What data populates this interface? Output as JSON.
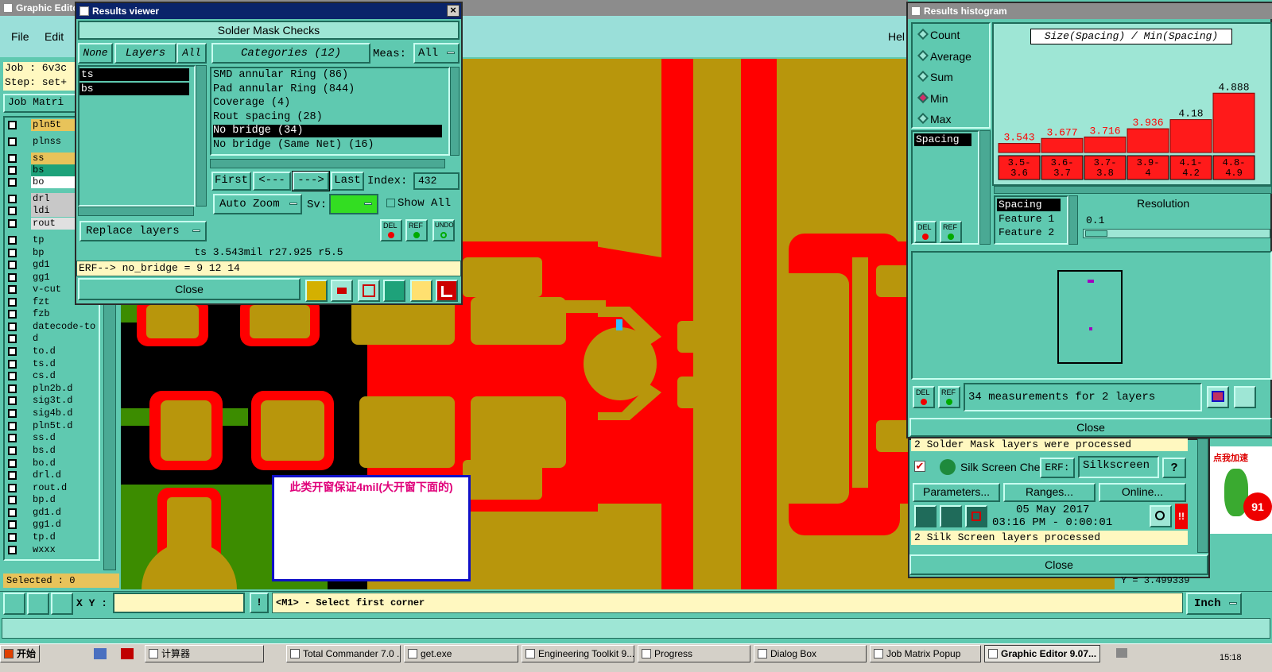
{
  "graphic_editor": {
    "title": "Graphic Edito",
    "menu_file": "File",
    "menu_edit": "Edit",
    "menu_help": "Hel",
    "job": "Job : 6v3c",
    "step": "Step: set+",
    "job_matrix": "Job Matri",
    "selected": "Selected : 0",
    "xy_label": "X Y :",
    "xy_value": "",
    "status_msg": "<M1> - Select first corner",
    "units": "Inch",
    "y_readout": "Y = 3.499339",
    "layers": [
      {
        "name": "pln5t",
        "bg": "#e8c35a"
      },
      {
        "name": "plnss",
        "bg": "#5fc9b0"
      },
      {
        "name": "ss",
        "bg": "#e8c35a"
      },
      {
        "name": "bs",
        "bg": "#1ea27a"
      },
      {
        "name": "bo",
        "bg": "#ffffff"
      },
      {
        "name": "drl",
        "bg": "#c8c8c8"
      },
      {
        "name": "ldi",
        "bg": "#c8c8c8"
      },
      {
        "name": "rout",
        "bg": "#e0e0e0"
      },
      {
        "name": "tp",
        "bg": "#5fc9b0"
      },
      {
        "name": "bp",
        "bg": "#5fc9b0"
      },
      {
        "name": "gd1",
        "bg": "#5fc9b0"
      },
      {
        "name": "gg1",
        "bg": "#5fc9b0"
      },
      {
        "name": "v-cut",
        "bg": "#5fc9b0"
      },
      {
        "name": "fzt",
        "bg": "#5fc9b0"
      },
      {
        "name": "fzb",
        "bg": "#5fc9b0"
      },
      {
        "name": "datecode-to",
        "bg": "#5fc9b0"
      },
      {
        "name": "d",
        "bg": "#5fc9b0"
      },
      {
        "name": "to.d",
        "bg": "#5fc9b0"
      },
      {
        "name": "ts.d",
        "bg": "#5fc9b0"
      },
      {
        "name": "cs.d",
        "bg": "#5fc9b0"
      },
      {
        "name": "pln2b.d",
        "bg": "#5fc9b0"
      },
      {
        "name": "sig3t.d",
        "bg": "#5fc9b0"
      },
      {
        "name": "sig4b.d",
        "bg": "#5fc9b0"
      },
      {
        "name": "pln5t.d",
        "bg": "#5fc9b0"
      },
      {
        "name": "ss.d",
        "bg": "#5fc9b0"
      },
      {
        "name": "bs.d",
        "bg": "#5fc9b0"
      },
      {
        "name": "bo.d",
        "bg": "#5fc9b0"
      },
      {
        "name": "drl.d",
        "bg": "#5fc9b0"
      },
      {
        "name": "rout.d",
        "bg": "#5fc9b0"
      },
      {
        "name": "bp.d",
        "bg": "#5fc9b0"
      },
      {
        "name": "gd1.d",
        "bg": "#5fc9b0"
      },
      {
        "name": "gg1.d",
        "bg": "#5fc9b0"
      },
      {
        "name": "tp.d",
        "bg": "#5fc9b0"
      },
      {
        "name": "wxxx",
        "bg": "#5fc9b0"
      }
    ]
  },
  "results_viewer": {
    "title": "Results viewer",
    "header": "Solder Mask Checks",
    "none": "None",
    "layers": "Layers",
    "all": "All",
    "categories": "Categories (12)",
    "meas_label": "Meas:",
    "meas_value": "All",
    "layer_list": [
      "ts",
      "bs"
    ],
    "category_list": [
      "SMD annular Ring (86)",
      "Pad annular Ring (844)",
      "Coverage (4)",
      "Rout spacing (28)",
      "No bridge (34)",
      "No bridge (Same Net) (16)"
    ],
    "selected_category": "No bridge (34)",
    "first": "First",
    "prev": "<---",
    "next": "--->",
    "last": "Last",
    "index_label": "Index:",
    "index_value": "432",
    "auto_zoom": "Auto Zoom",
    "sv_label": "Sv:",
    "show_all": "Show All",
    "replace_layers": "Replace layers",
    "del": "DEL",
    "ref": "REF",
    "undo": "UNDO",
    "measure_readout": "ts 3.543mil   r27.925  r5.5",
    "erf_line": "ERF--> no_bridge = 9 12 14",
    "close": "Close"
  },
  "annotation": {
    "text": "此类开窗保证4mil(大开窗下面的)"
  },
  "histogram": {
    "title": "Results histogram",
    "modes": [
      "Count",
      "Average",
      "Sum",
      "Min",
      "Max"
    ],
    "selected_mode": "Min",
    "chart_title": "Size(Spacing) / Min(Spacing)",
    "measure_list": [
      "Spacing"
    ],
    "detail_list": [
      "Spacing",
      "Feature 1",
      "Feature 2"
    ],
    "resolution_label": "Resolution",
    "resolution_value": "0.1",
    "measurement_count": "34 measurements for 2 layers",
    "del": "DEL",
    "ref": "REF",
    "close": "Close"
  },
  "chart_data": {
    "type": "bar",
    "title": "Size(Spacing) / Min(Spacing)",
    "categories": [
      "3.5-3.6",
      "3.6-3.7",
      "3.7-3.8",
      "3.9-4",
      "4.1-4.2",
      "4.8-4.9"
    ],
    "category_lines": [
      [
        "3.5-",
        "3.6"
      ],
      [
        "3.6-",
        "3.7"
      ],
      [
        "3.7-",
        "3.8"
      ],
      [
        "3.9-",
        "4"
      ],
      [
        "4.1-",
        "4.2"
      ],
      [
        "4.8-",
        "4.9"
      ]
    ],
    "values": [
      3.543,
      3.677,
      3.716,
      3.936,
      4.18,
      4.888
    ],
    "value_labels": [
      "3.543",
      "3.677",
      "3.716",
      "3.936",
      "4.18",
      "4.888"
    ],
    "value_colors": [
      "#ff0000",
      "#ff0000",
      "#ff0000",
      "#ff0000",
      "#000000",
      "#000000"
    ],
    "bar_color": "#ff1a1a"
  },
  "checklist": {
    "processed_solder": "2 Solder Mask layers were processed",
    "silk_name": "Silk Screen Che",
    "erf_label": "ERF:",
    "erf_value": "Silkscreen",
    "help": "?",
    "parameters": "Parameters...",
    "ranges": "Ranges...",
    "online": "Online...",
    "date": "05 May 2017",
    "time": "03:16 PM - 0:00:01",
    "processed_silk": "2 Silk Screen layers processed",
    "alert": "!!",
    "close": "Close"
  },
  "ad_badge": {
    "text": "点我加速",
    "number": "91"
  },
  "taskbar": {
    "start": "开始",
    "clock": "15:18",
    "items": [
      {
        "label": "计算器"
      },
      {
        "label": "Total Commander 7.0 ..."
      },
      {
        "label": "get.exe"
      },
      {
        "label": "Engineering Toolkit 9...."
      },
      {
        "label": "Progress"
      },
      {
        "label": "Dialog Box"
      },
      {
        "label": "Job Matrix Popup"
      },
      {
        "label": "Graphic Editor 9.07..."
      }
    ]
  }
}
